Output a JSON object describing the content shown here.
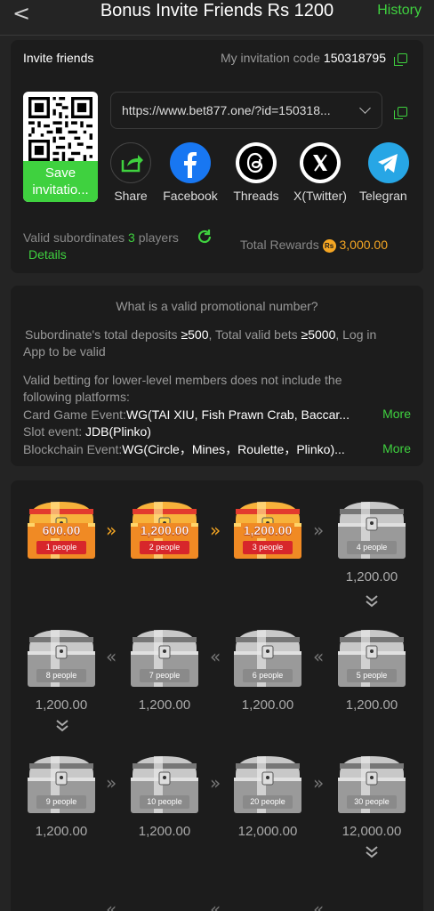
{
  "header": {
    "back": "<",
    "title": "Bonus Invite Friends Rs 1200",
    "history": "History"
  },
  "invite": {
    "label": "Invite friends",
    "code_label": "My invitation code",
    "code": "150318795",
    "url": "https://www.bet877.one/?id=150318...",
    "save_label": "Save invitatio...",
    "shares": [
      {
        "label": "Share",
        "icon": "share-icon"
      },
      {
        "label": "Facebook",
        "icon": "facebook-icon"
      },
      {
        "label": "Threads",
        "icon": "threads-icon"
      },
      {
        "label": "X(Twitter)",
        "icon": "x-icon"
      },
      {
        "label": "Telegran",
        "icon": "telegram-icon"
      }
    ],
    "valid_label": "Valid subordinates",
    "valid_count": "3",
    "valid_unit": "players",
    "details": "Details",
    "total_label": "Total Rewards",
    "rs_symbol": "Rs",
    "total_value": "3,000.00"
  },
  "rules": {
    "heading": "What is a valid promotional number?",
    "r1_a": "Subordinate's total deposits",
    "r1_b": "≥500",
    "r1_c": ", Total valid bets",
    "r1_d": "≥5000",
    "r1_e": ", Log in",
    "r1_f": "App to be valid",
    "r2_a": "Valid betting for lower-level members does not include the",
    "r2_b": "following platforms:",
    "card_lbl": "Card Game Event:",
    "card_val": "WG(TAI XIU, Fish Prawn Crab, Baccar...",
    "slot_lbl": "Slot event:",
    "slot_val": "JDB(Plinko)",
    "block_lbl": "Blockchain Event:",
    "block_val": "WG(Circle，Mines，Roulette，Plinko)...",
    "more": "More"
  },
  "rewards": [
    {
      "people": "1 people",
      "value": "600.00",
      "unlocked": true
    },
    {
      "people": "2 people",
      "value": "1,200.00",
      "unlocked": true
    },
    {
      "people": "3 people",
      "value": "1,200.00",
      "unlocked": true
    },
    {
      "people": "4 people",
      "value": "1,200.00",
      "unlocked": false
    },
    {
      "people": "5 people",
      "value": "1,200.00",
      "unlocked": false
    },
    {
      "people": "6 people",
      "value": "1,200.00",
      "unlocked": false
    },
    {
      "people": "7 people",
      "value": "1,200.00",
      "unlocked": false
    },
    {
      "people": "8 people",
      "value": "1,200.00",
      "unlocked": false
    },
    {
      "people": "9 people",
      "value": "1,200.00",
      "unlocked": false
    },
    {
      "people": "10 people",
      "value": "1,200.00",
      "unlocked": false
    },
    {
      "people": "20 people",
      "value": "12,000.00",
      "unlocked": false
    },
    {
      "people": "30 people",
      "value": "12,000.00",
      "unlocked": false
    }
  ],
  "colors": {
    "accent": "#3fd13f",
    "gold": "#f5a623",
    "bg": "#242424",
    "card": "#1c1c1c"
  }
}
